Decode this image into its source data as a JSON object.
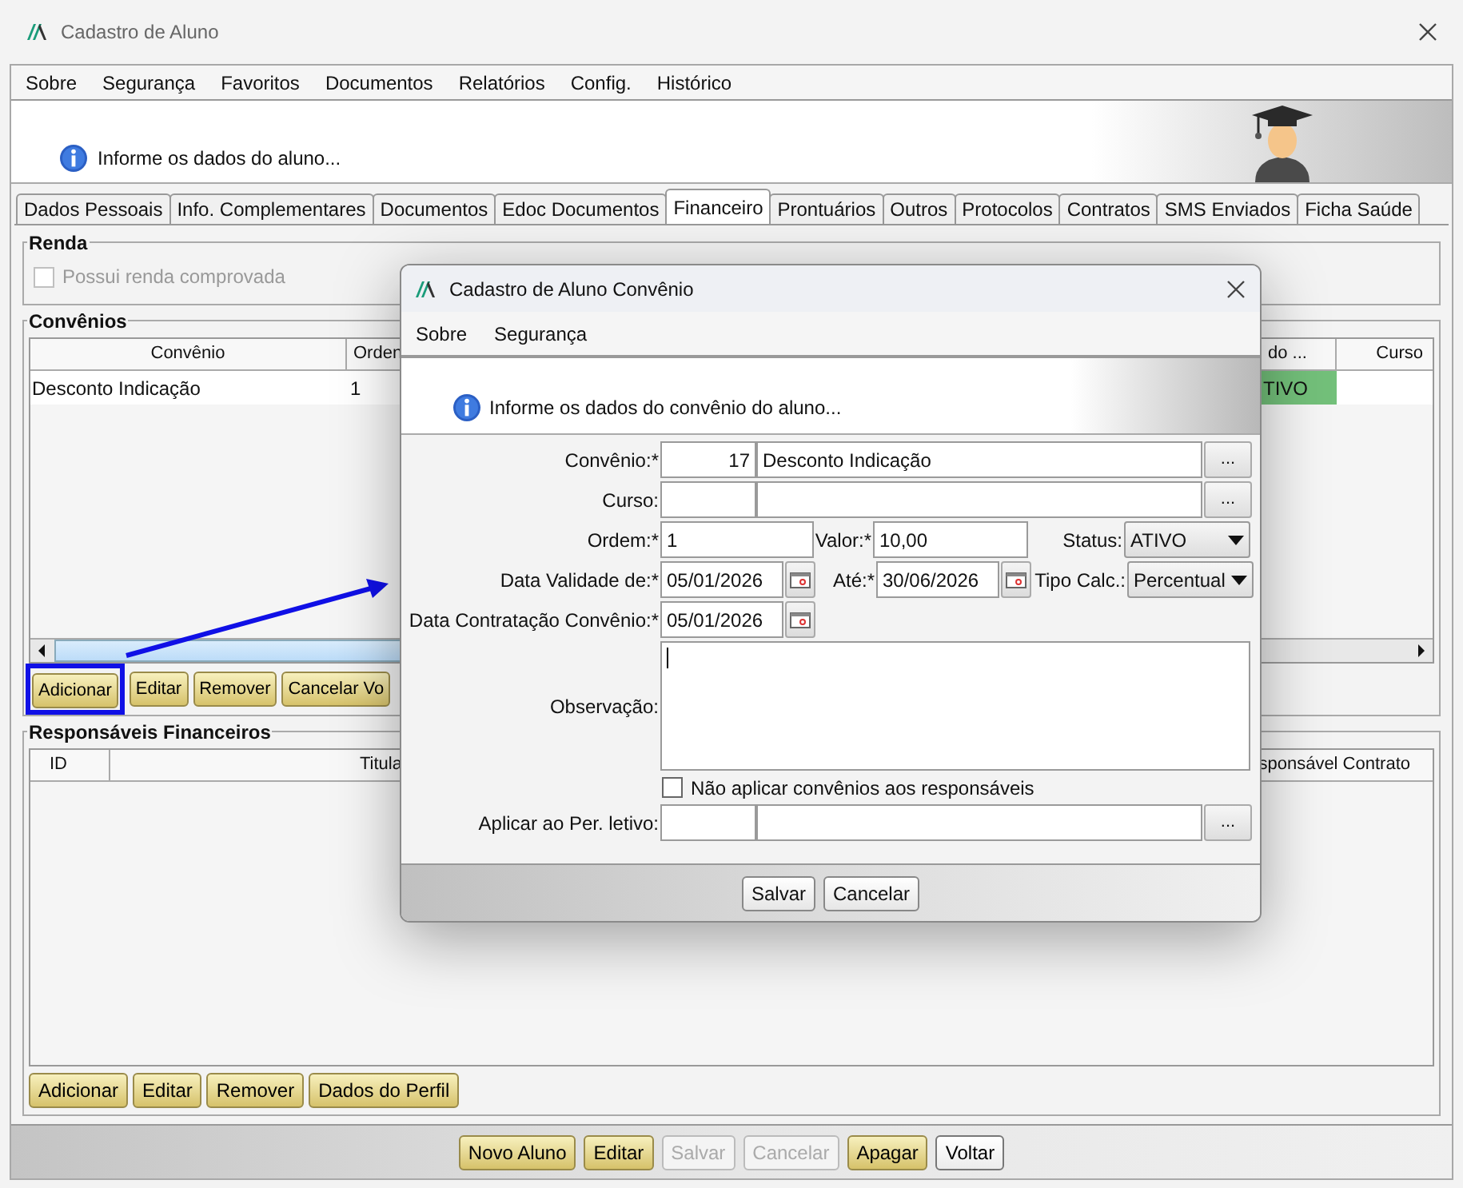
{
  "window": {
    "title": "Cadastro de Aluno"
  },
  "menu": [
    "Sobre",
    "Segurança",
    "Favoritos",
    "Documentos",
    "Relatórios",
    "Config.",
    "Histórico"
  ],
  "info": "Informe os dados do aluno...",
  "tabs": [
    {
      "label": "Dados Pessoais",
      "selected": false
    },
    {
      "label": "Info. Complementares",
      "selected": false
    },
    {
      "label": "Documentos",
      "selected": false
    },
    {
      "label": "Edoc Documentos",
      "selected": false
    },
    {
      "label": "Financeiro",
      "selected": true
    },
    {
      "label": "Prontuários",
      "selected": false
    },
    {
      "label": "Outros",
      "selected": false
    },
    {
      "label": "Protocolos",
      "selected": false
    },
    {
      "label": "Contratos",
      "selected": false
    },
    {
      "label": "SMS Enviados",
      "selected": false
    },
    {
      "label": "Ficha Saúde",
      "selected": false
    }
  ],
  "renda": {
    "title": "Renda",
    "checkbox": {
      "label": "Possui renda comprovada",
      "checked": false,
      "disabled": true
    }
  },
  "convenios": {
    "title": "Convênios",
    "columns": [
      "Convênio",
      "Orden",
      "do ...",
      "Curso"
    ],
    "rows": [
      {
        "convenio": "Desconto Indicação",
        "column_2": "1",
        "column_3": "TIVO"
      }
    ],
    "buttons": [
      {
        "label": "Adicionar",
        "highlighted": true
      },
      {
        "label": "Editar",
        "highlighted": false
      },
      {
        "label": "Remover",
        "highlighted": false
      },
      {
        "label": "Cancelar Vo",
        "highlighted": false
      }
    ]
  },
  "responsaveis": {
    "title": "Responsáveis Financeiros",
    "columns": [
      "ID",
      "Titula",
      "sponsável Contrato"
    ],
    "buttons": [
      "Adicionar",
      "Editar",
      "Remover",
      "Dados do Perfil"
    ]
  },
  "footer_buttons": [
    {
      "label": "Novo Aluno",
      "disabled": false,
      "kind": "gold"
    },
    {
      "label": "Editar",
      "disabled": false,
      "kind": "gold"
    },
    {
      "label": "Salvar",
      "disabled": true,
      "kind": "gold"
    },
    {
      "label": "Cancelar",
      "disabled": true,
      "kind": "gold"
    },
    {
      "label": "Apagar",
      "disabled": false,
      "kind": "gold"
    },
    {
      "label": "Voltar",
      "disabled": false,
      "kind": "plain"
    }
  ],
  "dialog": {
    "title": "Cadastro de Aluno Convênio",
    "menu": [
      "Sobre",
      "Segurança"
    ],
    "info": "Informe os dados do convênio do aluno...",
    "convenio": {
      "label": "Convênio:*",
      "code": "17",
      "name": "Desconto Indicação",
      "lookup": "..."
    },
    "curso": {
      "label": "Curso:",
      "lookup": "..."
    },
    "ordem": {
      "label": "Ordem:*",
      "value": "1"
    },
    "valor": {
      "label": "Valor:*",
      "value": "10,00"
    },
    "status": {
      "label": "Status:",
      "value": "ATIVO"
    },
    "validade_de": {
      "label": "Data Validade de:*",
      "value": "05/01/2026"
    },
    "ate": {
      "label": "Até:*",
      "value": "30/06/2026"
    },
    "tipo_calc": {
      "label": "Tipo Calc.:",
      "value": "Percentual"
    },
    "contratacao": {
      "label": "Data Contratação Convênio:*",
      "value": "05/01/2026"
    },
    "observacao": {
      "label": "Observação:"
    },
    "nao_aplicar": {
      "label": "Não aplicar convênios aos responsáveis",
      "checked": false
    },
    "per_letivo": {
      "label": "Aplicar ao Per. letivo:",
      "lookup": "..."
    },
    "buttons": [
      "Salvar",
      "Cancelar"
    ]
  }
}
